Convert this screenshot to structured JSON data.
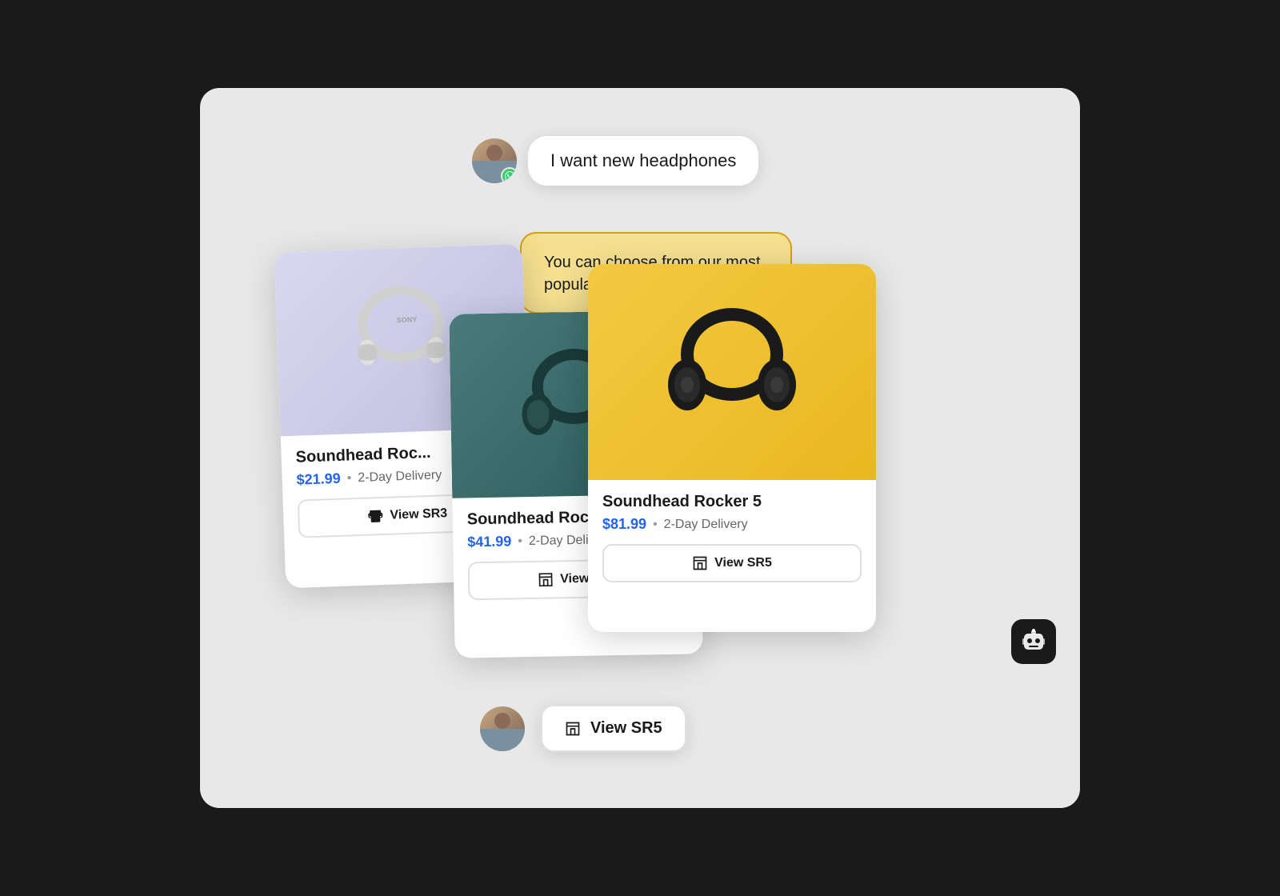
{
  "scene": {
    "background": "#e8e8e8"
  },
  "user_message": {
    "text": "I want new headphones",
    "avatar_alt": "user avatar"
  },
  "bot_response": {
    "text": "You can choose from our most popular choices:"
  },
  "products": [
    {
      "id": "sr3",
      "name": "Soundhead Rocker 3",
      "name_short": "Soundhead Roc...",
      "price": "$21.99",
      "delivery": "2-Day Delivery",
      "button_label": "View SR3",
      "image_bg": "#d8d8f0",
      "headphone_color": "white"
    },
    {
      "id": "sr4",
      "name": "Soundhead Rocker 4",
      "name_short": "Soundhead Rock...",
      "price": "$41.99",
      "delivery": "2-Day Delivery",
      "button_label": "View SR4",
      "image_bg": "#4a7a7a",
      "headphone_color": "dark"
    },
    {
      "id": "sr5",
      "name": "Soundhead Rocker 5",
      "price": "$81.99",
      "delivery": "2-Day Delivery",
      "button_label": "View SR5",
      "image_bg": "#f5c842",
      "headphone_color": "black"
    }
  ],
  "bottom_button": {
    "label": "View SR5"
  },
  "whatsapp": {
    "color": "#25D366"
  },
  "icons": {
    "store": "store-icon",
    "whatsapp": "whatsapp-icon",
    "bot": "bot-icon"
  }
}
